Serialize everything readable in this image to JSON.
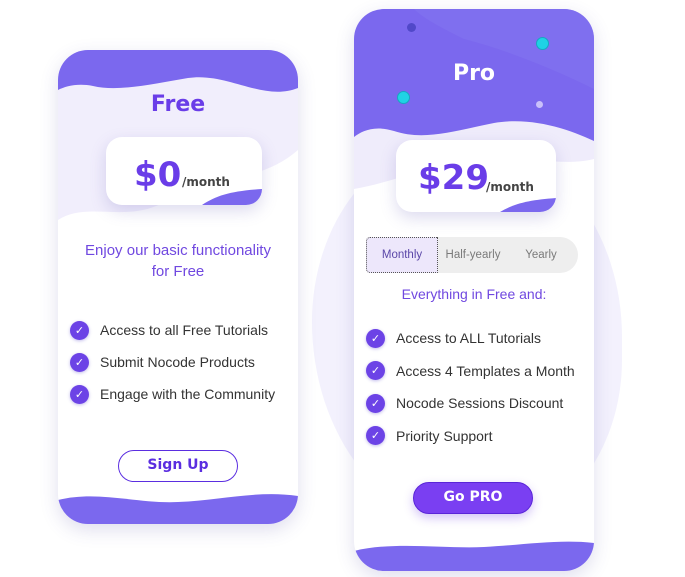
{
  "colors": {
    "accent": "#6a3de8",
    "wave_dark": "#7b68ee",
    "wave_light": "#ebe7fb",
    "button_fill": "#7a3ff2",
    "dot_cyan": "#1fd2e5",
    "dot_indigo": "#5148c9"
  },
  "free": {
    "name": "Free",
    "price": "$0",
    "unit": "/month",
    "tagline_line1": "Enjoy our basic functionality",
    "tagline_line2": "for Free",
    "features": [
      "Access to all Free Tutorials",
      "Submit Nocode Products",
      "Engage with the Community"
    ],
    "button_label": "Sign Up"
  },
  "pro": {
    "name": "Pro",
    "price": "$29",
    "unit": "/month",
    "billing_options": [
      "Monthly",
      "Half-yearly",
      "Yearly"
    ],
    "selected_billing": "Monthly",
    "tagline": "Everything in Free and:",
    "features": [
      "Access to ALL Tutorials",
      "Access 4 Templates a Month",
      "Nocode Sessions Discount",
      "Priority Support"
    ],
    "button_label": "Go PRO"
  },
  "icons": {
    "feature_check": "check-circle-icon"
  }
}
